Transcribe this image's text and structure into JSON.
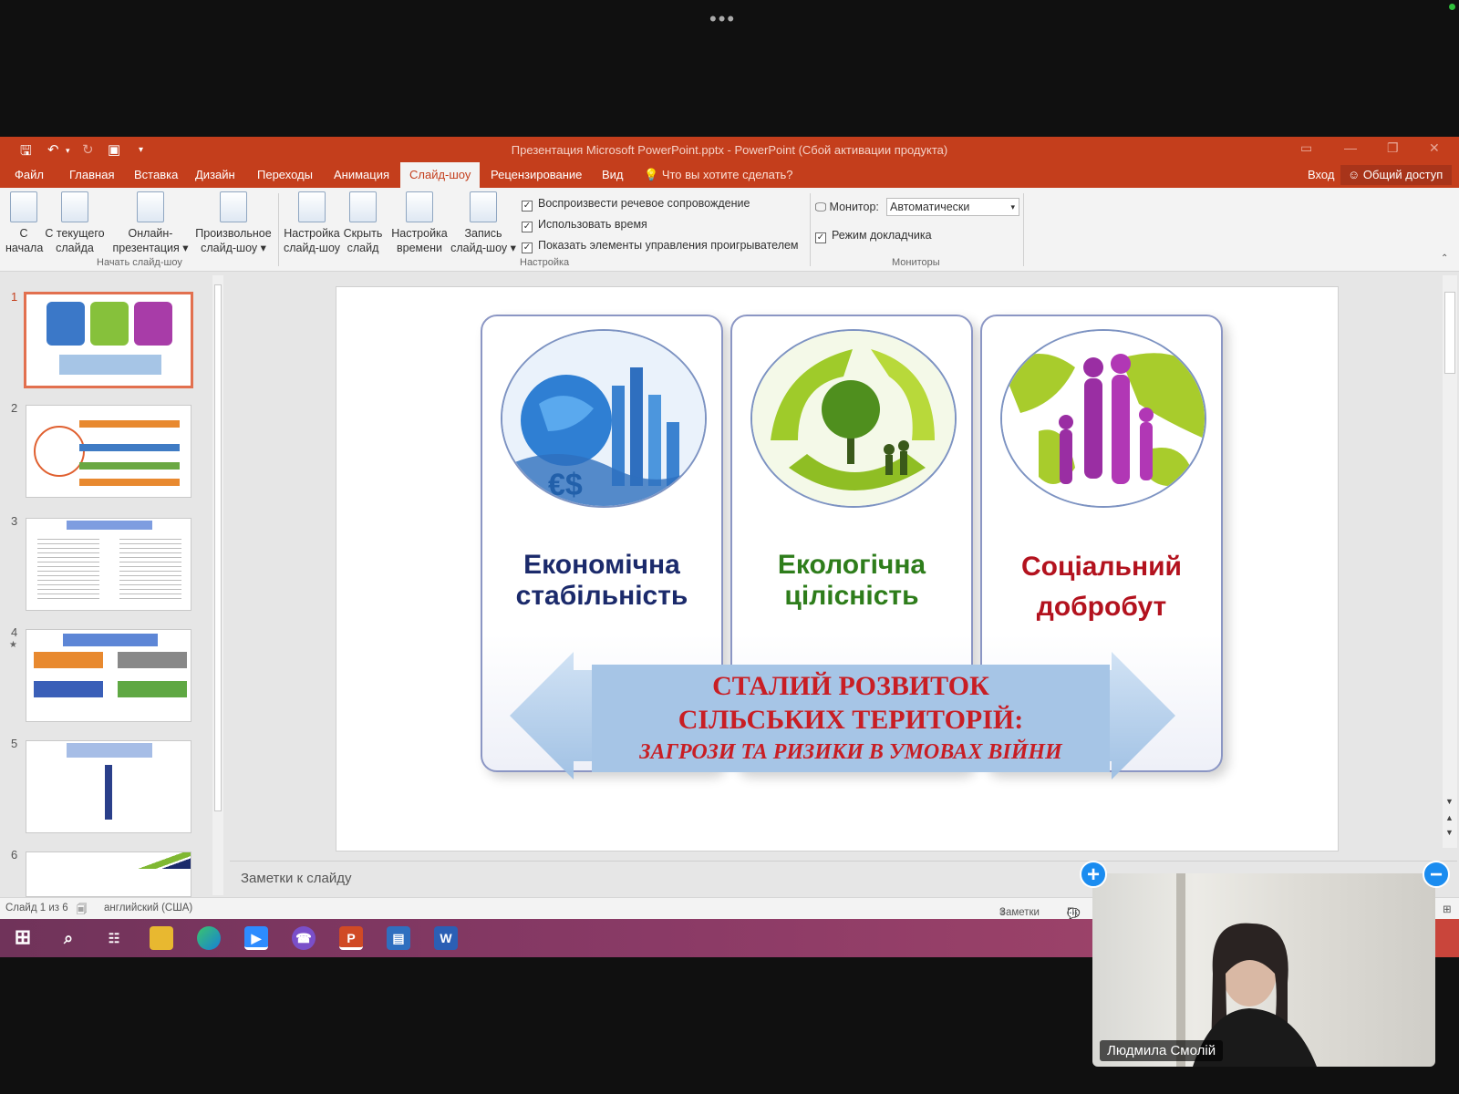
{
  "window": {
    "title": "Презентация Microsoft PowerPoint.pptx - PowerPoint (Сбой активации продукта)"
  },
  "zoom": {
    "more_dots": "•••",
    "participant_name": "Людмила Смолій"
  },
  "menu": {
    "tabs": [
      "Файл",
      "Главная",
      "Вставка",
      "Дизайн",
      "Переходы",
      "Анимация",
      "Слайд-шоу",
      "Рецензирование",
      "Вид"
    ],
    "active_tab": "Слайд-шоу",
    "tell_me": "Что вы хотите сделать?",
    "signin": "Вход",
    "share": "Общий доступ"
  },
  "ribbon": {
    "start_group": {
      "label": "Начать слайд-шоу",
      "buttons": [
        {
          "line1": "С",
          "line2": "начала"
        },
        {
          "line1": "С текущего",
          "line2": "слайда"
        },
        {
          "line1": "Онлайн-",
          "line2": "презентация ▾"
        },
        {
          "line1": "Произвольное",
          "line2": "слайд-шоу ▾"
        }
      ]
    },
    "setup_group": {
      "label": "Настройка",
      "buttons": [
        {
          "line1": "Настройка",
          "line2": "слайд-шоу"
        },
        {
          "line1": "Скрыть",
          "line2": "слайд"
        },
        {
          "line1": "Настройка",
          "line2": "времени"
        },
        {
          "line1": "Запись",
          "line2": "слайд-шоу ▾"
        }
      ],
      "checkboxes": [
        {
          "label": "Воспроизвести речевое сопровождение",
          "checked": true
        },
        {
          "label": "Использовать время",
          "checked": true
        },
        {
          "label": "Показать элементы управления проигрывателем",
          "checked": true
        }
      ]
    },
    "monitors_group": {
      "label": "Мониторы",
      "monitor_label": "Монитор:",
      "monitor_value": "Автоматически",
      "presenter_view": {
        "label": "Режим докладчика",
        "checked": true
      }
    }
  },
  "thumbnails": {
    "numbers": [
      "1",
      "2",
      "3",
      "4",
      "5",
      "6"
    ],
    "selected": 1
  },
  "slide": {
    "cards": [
      {
        "line1": "Економічна",
        "line2": "стабільність",
        "color": "#1b2a6b"
      },
      {
        "line1": "Екологічна",
        "line2": "цілісність",
        "color": "#2e7d1b"
      },
      {
        "line1": "Соціальний",
        "line2": "добробут",
        "color": "#b3121e"
      }
    ],
    "banner": {
      "line1": "СТАЛИЙ РОЗВИТОК",
      "line2": "СІЛЬСЬКИХ ТЕРИТОРІЙ:",
      "line3": "ЗАГРОЗИ ТА РИЗИКИ В УМОВАХ  ВІЙНИ"
    }
  },
  "notes": {
    "placeholder": "Заметки к слайду"
  },
  "statusbar": {
    "slide_info": "Слайд 1 из 6",
    "language": "английский (США)",
    "notes": "Заметки",
    "comments": "Пр"
  },
  "colors": {
    "accent": "#c43e1c",
    "banner": "#a6c5e6"
  }
}
